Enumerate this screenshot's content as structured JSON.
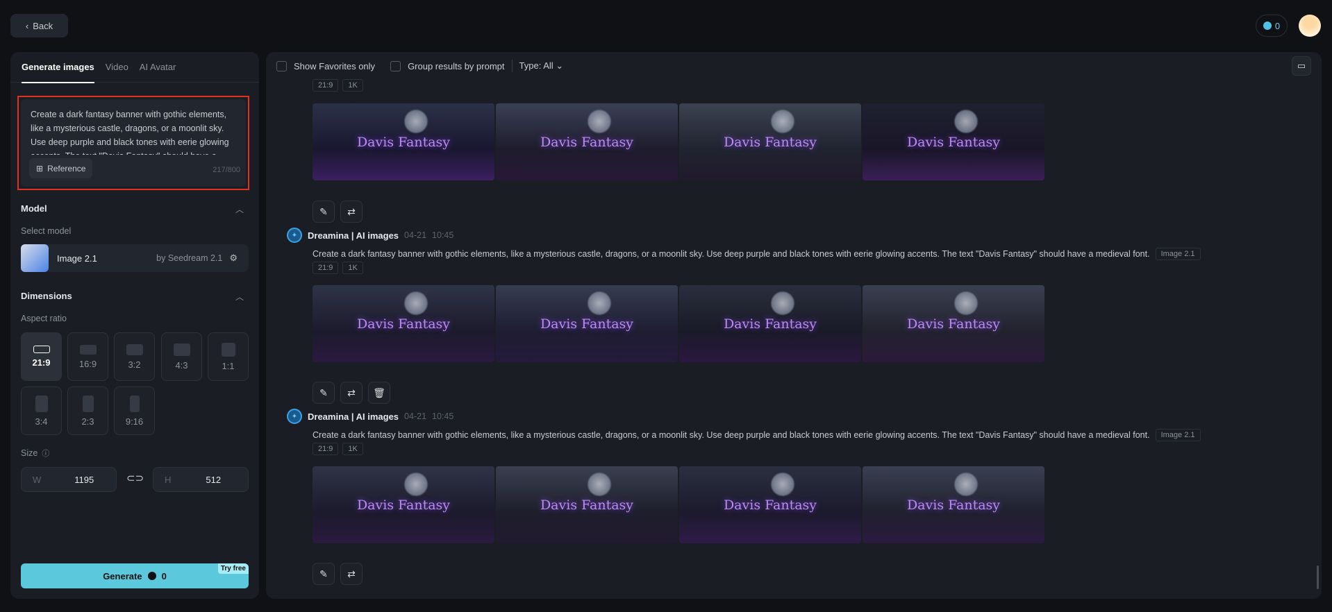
{
  "header": {
    "back_label": "Back",
    "credits": "0"
  },
  "left": {
    "tabs": [
      "Generate images",
      "Video",
      "AI Avatar"
    ],
    "prompt": "Create a dark fantasy banner with gothic elements, like a mysterious castle, dragons, or a moonlit sky. Use deep purple and black tones with eerie glowing accents. The text \"Davis Fantasy\" should have a medieval font.",
    "reference_label": "Reference",
    "char_count": "217/800",
    "model_section": "Model",
    "select_model_label": "Select model",
    "model_name": "Image 2.1",
    "model_by": "by Seedream 2.1",
    "dimensions_section": "Dimensions",
    "aspect_ratio_label": "Aspect ratio",
    "ratios": [
      "21:9",
      "16:9",
      "3:2",
      "4:3",
      "1:1",
      "3:4",
      "2:3",
      "9:16"
    ],
    "selected_ratio": "21:9",
    "size_label": "Size",
    "width_label": "W",
    "width": "1195",
    "height_label": "H",
    "height": "512",
    "generate_label": "Generate",
    "generate_cost": "0",
    "try_free": "Try free"
  },
  "toolbar": {
    "favorites": "Show Favorites only",
    "group": "Group results by prompt",
    "type": "Type: All"
  },
  "groups": [
    {
      "tags": [
        "21:9",
        "1K"
      ],
      "images": [
        "Davis Fantasy",
        "Davis Fantasy",
        "Davis Fantasy",
        "Davis Fantasy"
      ]
    },
    {
      "source": "Dreamina | AI images",
      "date": "04-21",
      "time": "10:45",
      "prompt": "Create a dark fantasy banner with gothic elements, like a mysterious castle, dragons, or a moonlit sky. Use deep purple and black tones with eerie glowing accents. The text \"Davis Fantasy\" should have a medieval font.",
      "model": "Image 2.1",
      "tags": [
        "21:9",
        "1K"
      ],
      "images": [
        "Davis Fantasy",
        "Davis Fantasy",
        "Davis Fantasy",
        "Davis Fantasy"
      ]
    },
    {
      "source": "Dreamina | AI images",
      "date": "04-21",
      "time": "10:45",
      "prompt": "Create a dark fantasy banner with gothic elements, like a mysterious castle, dragons, or a moonlit sky. Use deep purple and black tones with eerie glowing accents. The text \"Davis Fantasy\" should have a medieval font.",
      "model": "Image 2.1",
      "tags": [
        "21:9",
        "1K"
      ],
      "images": [
        "Davis Fantasy",
        "Davis Fantasy",
        "Davis Fantasy",
        "Davis Fantasy"
      ]
    }
  ]
}
